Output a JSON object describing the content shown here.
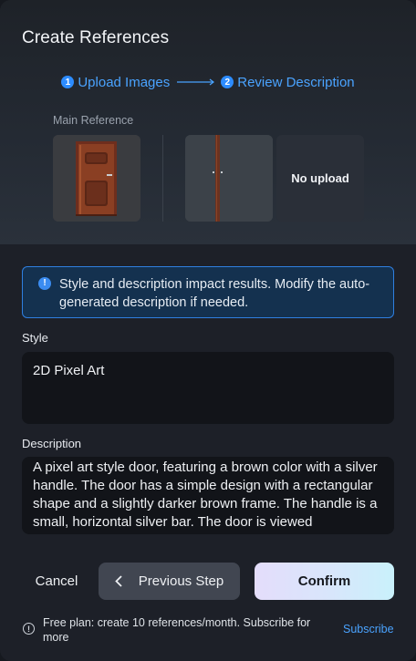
{
  "dialog": {
    "title": "Create References"
  },
  "stepper": {
    "steps": [
      {
        "number": "1",
        "label": "Upload Images"
      },
      {
        "number": "2",
        "label": "Review Description"
      }
    ],
    "active_color": "#4aa3ff"
  },
  "references": {
    "main_label": "Main Reference",
    "empty_label": "No upload"
  },
  "info": {
    "icon": "!",
    "message": "Style and description impact results. Modify the auto-generated description if needed."
  },
  "style_field": {
    "label": "Style",
    "value": "2D Pixel Art"
  },
  "description_field": {
    "label": "Description",
    "value": "A pixel art style door, featuring a brown color with a silver handle. The door has a simple design with a rectangular shape and a slightly darker brown frame. The handle is a small, horizontal silver bar. The door is viewed"
  },
  "actions": {
    "cancel_label": "Cancel",
    "prev_icon": "chevron-left-icon",
    "prev_label": "Previous Step",
    "confirm_label": "Confirm"
  },
  "footer": {
    "icon": "!",
    "text": "Free plan: create 10 references/month. Subscribe for more",
    "subscribe_label": "Subscribe"
  }
}
